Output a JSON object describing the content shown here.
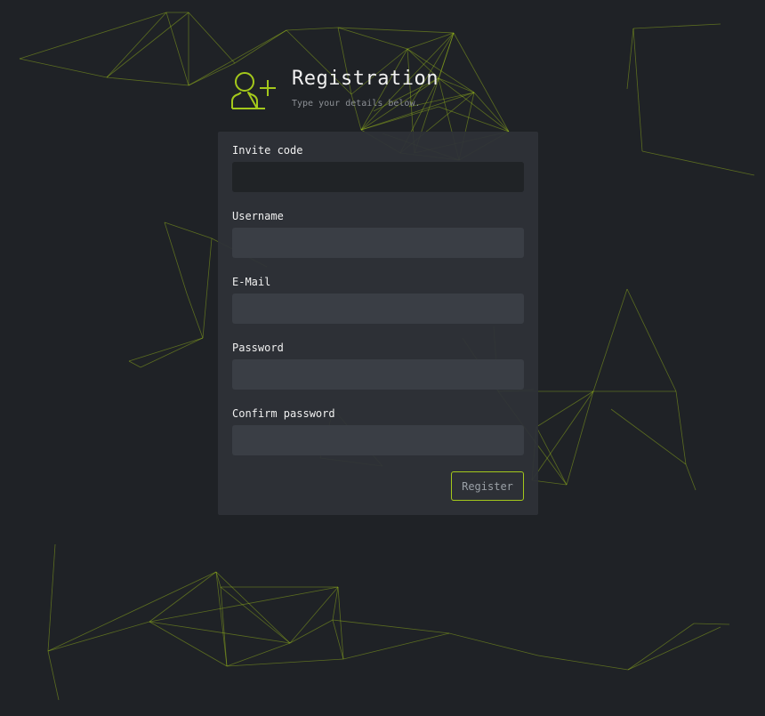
{
  "header": {
    "title": "Registration",
    "subtitle": "Type your details below.",
    "icon": "add-user-icon"
  },
  "form": {
    "fields": [
      {
        "label": "Invite code",
        "value": "",
        "focused": true
      },
      {
        "label": "Username",
        "value": ""
      },
      {
        "label": "E-Mail",
        "value": ""
      },
      {
        "label": "Password",
        "value": ""
      },
      {
        "label": "Confirm password",
        "value": ""
      }
    ],
    "submit_label": "Register"
  },
  "colors": {
    "accent": "#a4c81b",
    "background": "#1f2226",
    "card": "#2e3238",
    "input": "#3a3e45"
  }
}
